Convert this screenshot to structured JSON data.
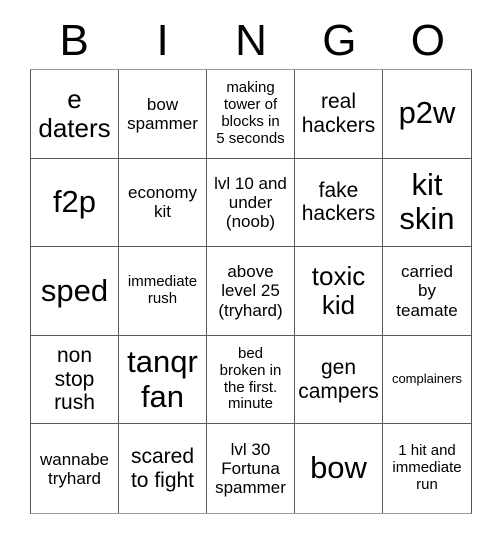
{
  "card": {
    "title": "BINGO",
    "header_letters": [
      "B",
      "I",
      "N",
      "G",
      "O"
    ],
    "colors": {
      "background": "#ffffff",
      "text": "#000000",
      "grid_line": "#5a5a5a",
      "grid_outer": "#999999"
    },
    "grid": {
      "columns": 5,
      "rows": 5,
      "cells": [
        {
          "text": "e\ndaters",
          "size": "lg"
        },
        {
          "text": "bow\nspammer",
          "size": "sm"
        },
        {
          "text": "making\ntower of\nblocks in\n5 seconds",
          "size": "xs"
        },
        {
          "text": "real\nhackers",
          "size": "md"
        },
        {
          "text": "p2w",
          "size": "xl"
        },
        {
          "text": "f2p",
          "size": "xl"
        },
        {
          "text": "economy\nkit",
          "size": "sm"
        },
        {
          "text": "lvl 10 and\nunder\n(noob)",
          "size": "sm"
        },
        {
          "text": "fake\nhackers",
          "size": "md"
        },
        {
          "text": "kit\nskin",
          "size": "xl"
        },
        {
          "text": "sped",
          "size": "xl"
        },
        {
          "text": "immediate\nrush",
          "size": "xs"
        },
        {
          "text": "above\nlevel 25\n(tryhard)",
          "size": "sm"
        },
        {
          "text": "toxic\nkid",
          "size": "lg"
        },
        {
          "text": "carried\nby\nteamate",
          "size": "sm"
        },
        {
          "text": "non\nstop\nrush",
          "size": "md"
        },
        {
          "text": "tanqr\nfan",
          "size": "xl"
        },
        {
          "text": "bed\nbroken in\nthe first.\nminute",
          "size": "xs"
        },
        {
          "text": "gen\ncampers",
          "size": "md"
        },
        {
          "text": "complainers",
          "size": "xxs"
        },
        {
          "text": "wannabe\ntryhard",
          "size": "sm"
        },
        {
          "text": "scared\nto fight",
          "size": "md"
        },
        {
          "text": "lvl 30\nFortuna\nspammer",
          "size": "sm"
        },
        {
          "text": "bow",
          "size": "xl"
        },
        {
          "text": "1 hit and\nimmediate\nrun",
          "size": "xs"
        }
      ]
    }
  }
}
